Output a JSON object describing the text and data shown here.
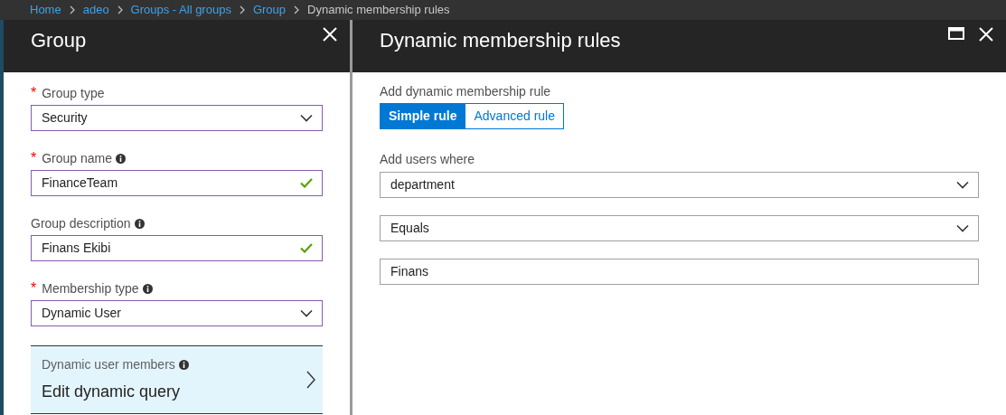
{
  "breadcrumb": [
    {
      "label": "Home",
      "link": true
    },
    {
      "label": "adeo",
      "link": true
    },
    {
      "label": "Groups - All groups",
      "link": true
    },
    {
      "label": "Group",
      "link": true
    },
    {
      "label": "Dynamic membership rules",
      "link": false
    }
  ],
  "left_blade": {
    "title": "Group",
    "fields": [
      {
        "kind": "select",
        "required_mark": "*",
        "label": "Group type",
        "info": false,
        "value": "Security",
        "valid": false
      },
      {
        "kind": "text",
        "required_mark": "*",
        "label": "Group name",
        "info": true,
        "value": "FinanceTeam",
        "valid": true
      },
      {
        "kind": "text",
        "label": "Group description",
        "info": true,
        "value": "Finans Ekibi",
        "valid": true
      },
      {
        "kind": "select",
        "required_mark": "*",
        "label": "Membership type",
        "info": true,
        "value": "Dynamic User",
        "valid": false
      }
    ],
    "nav_card": {
      "label": "Dynamic user members",
      "info": true,
      "value": "Edit dynamic query"
    }
  },
  "right_blade": {
    "title": "Dynamic membership rules",
    "rule_label": "Add dynamic membership rule",
    "rule_tabs": [
      {
        "label": "Simple rule",
        "selected": true
      },
      {
        "label": "Advanced rule",
        "selected": false
      }
    ],
    "conditions_label": "Add users where",
    "fields": [
      {
        "kind": "select",
        "value": "department"
      },
      {
        "kind": "select",
        "value": "Equals"
      },
      {
        "kind": "text",
        "value": "Finans"
      }
    ]
  }
}
